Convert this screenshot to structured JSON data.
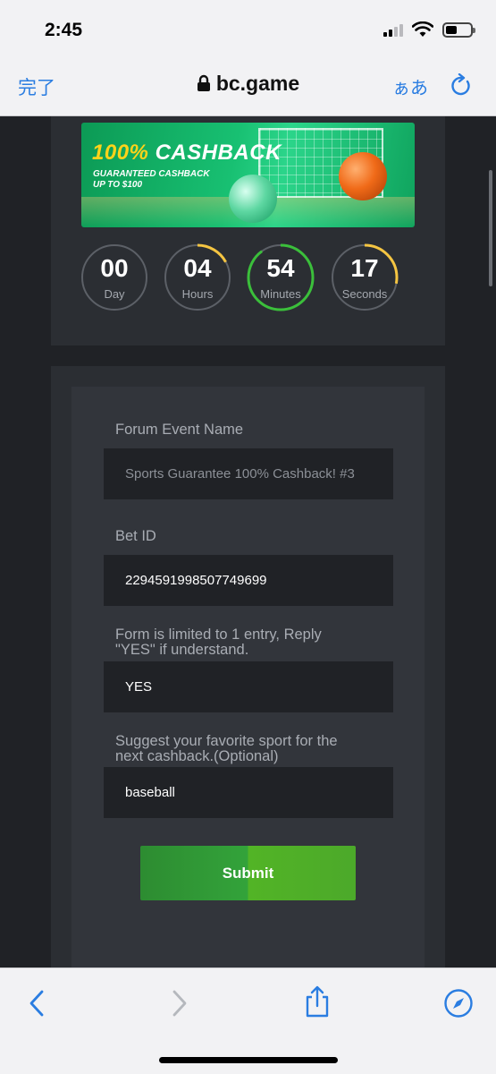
{
  "status": {
    "time": "2:45",
    "battery_level": 0.45,
    "signal_bars": 2
  },
  "browser": {
    "done_label": "完了",
    "url": "bc.game",
    "text_size_label": "ぁあ"
  },
  "banner": {
    "title_highlight": "100%",
    "title_rest": "CASHBACK",
    "subtitle_line1": "GUARANTEED CASHBACK",
    "subtitle_line2": "UP TO $100"
  },
  "countdown": [
    {
      "value": "00",
      "label": "Day",
      "progress": 0.0,
      "color": "#f5c542"
    },
    {
      "value": "04",
      "label": "Hours",
      "progress": 0.17,
      "color": "#f5c542"
    },
    {
      "value": "54",
      "label": "Minutes",
      "progress": 0.9,
      "color": "#3bbf3b"
    },
    {
      "value": "17",
      "label": "Seconds",
      "progress": 0.28,
      "color": "#f5c542"
    }
  ],
  "form": {
    "fields": [
      {
        "label": "Forum Event Name",
        "value": "Sports Guarantee 100% Cashback! #3"
      },
      {
        "label": "Bet ID",
        "value": "2294591998507749699"
      },
      {
        "label_line1": "Form is limited to 1 entry, Reply",
        "label_line2": "\"YES\" if understand.",
        "value": "YES"
      },
      {
        "label_line1": "Suggest your favorite sport for the",
        "label_line2": "next cashback.(Optional)",
        "value": "baseball"
      }
    ],
    "submit_label": "Submit"
  },
  "colors": {
    "accent_blue": "#2a7de1",
    "submit_green": "#3aa336",
    "page_bg": "#202226"
  }
}
